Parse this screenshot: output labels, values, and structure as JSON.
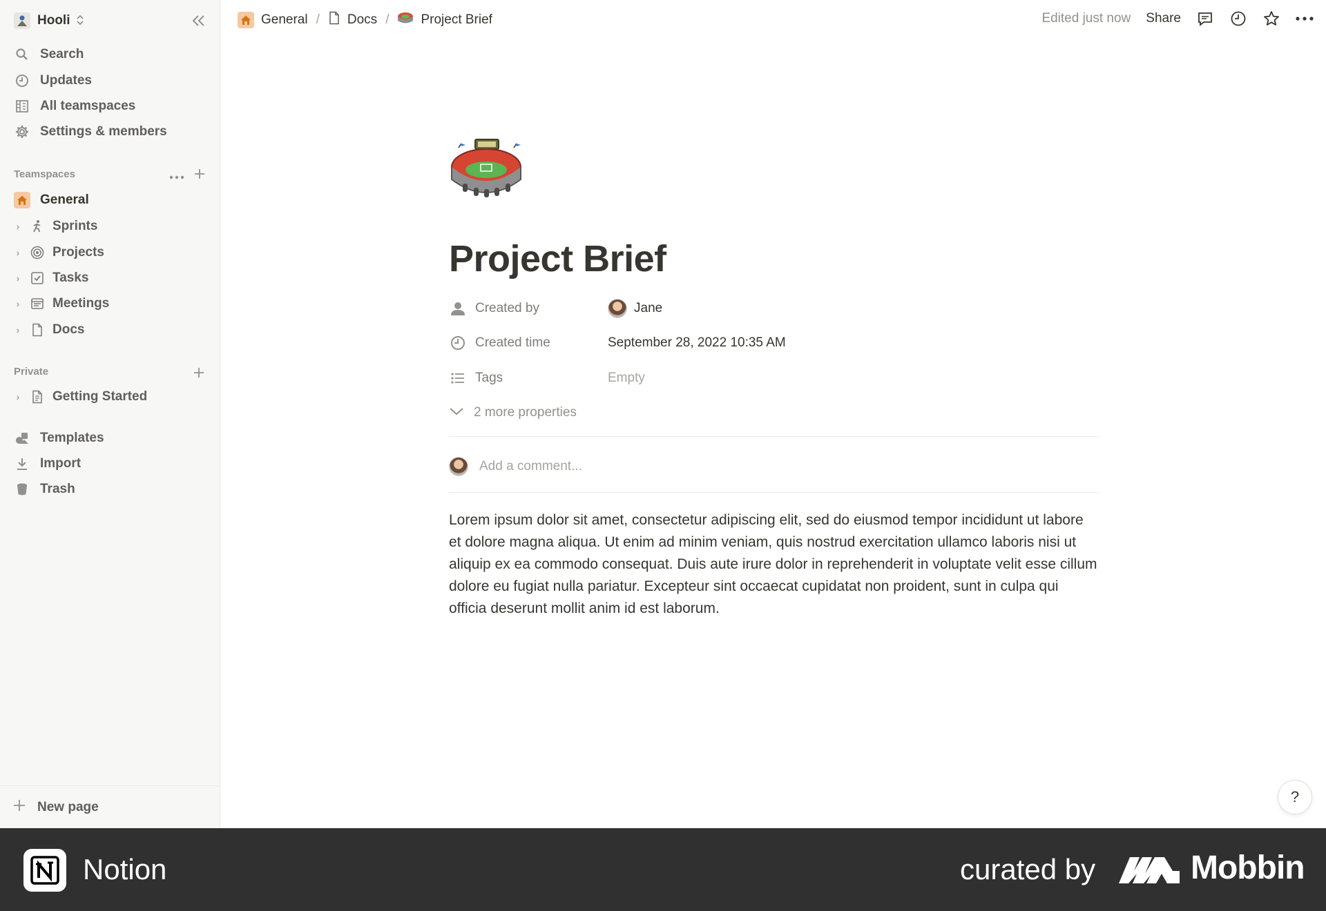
{
  "workspace": {
    "name": "Hooli"
  },
  "sidebar": {
    "nav": [
      {
        "label": "Search",
        "icon": "search-icon"
      },
      {
        "label": "Updates",
        "icon": "clock-icon"
      },
      {
        "label": "All teamspaces",
        "icon": "building-icon"
      },
      {
        "label": "Settings & members",
        "icon": "gear-icon"
      }
    ],
    "teamspaces_label": "Teamspaces",
    "teamspaces": [
      {
        "label": "General",
        "icon": "home-icon"
      },
      {
        "label": "Sprints",
        "icon": "runner-icon"
      },
      {
        "label": "Projects",
        "icon": "target-icon"
      },
      {
        "label": "Tasks",
        "icon": "checkbox-icon"
      },
      {
        "label": "Meetings",
        "icon": "notes-icon"
      },
      {
        "label": "Docs",
        "icon": "page-icon"
      }
    ],
    "private_label": "Private",
    "private": [
      {
        "label": "Getting Started",
        "icon": "document-icon"
      }
    ],
    "bottom": [
      {
        "label": "Templates",
        "icon": "shapes-icon"
      },
      {
        "label": "Import",
        "icon": "download-icon"
      },
      {
        "label": "Trash",
        "icon": "trash-icon"
      }
    ],
    "new_page_label": "New page"
  },
  "topbar": {
    "breadcrumbs": [
      "General",
      "Docs",
      "Project Brief"
    ],
    "edited": "Edited just now",
    "share": "Share"
  },
  "page": {
    "title": "Project Brief",
    "properties": [
      {
        "name": "Created by",
        "value": "Jane",
        "icon": "person-icon"
      },
      {
        "name": "Created time",
        "value": "September 28, 2022 10:35 AM",
        "icon": "clock-icon"
      },
      {
        "name": "Tags",
        "value": "Empty",
        "icon": "list-icon"
      }
    ],
    "more_properties": "2 more properties",
    "comment_placeholder": "Add a comment...",
    "body": "Lorem ipsum dolor sit amet, consectetur adipiscing elit, sed do eiusmod tempor incididunt ut labore et dolore magna aliqua. Ut enim ad minim veniam, quis nostrud exercitation ullamco laboris nisi ut aliquip ex ea commodo consequat. Duis aute irure dolor in reprehenderit in voluptate velit esse cillum dolore eu fugiat nulla pariatur. Excepteur sint occaecat cupidatat non proident, sunt in culpa qui officia deserunt mollit anim id est laborum."
  },
  "help_label": "?",
  "footer": {
    "app_name": "Notion",
    "curated_by": "curated by",
    "brand": "Mobbin"
  },
  "colors": {
    "sidebar_bg": "#f7f7f5",
    "text": "#37352f",
    "muted": "#91918e",
    "footer_bg": "#303030",
    "home_icon_bg": "#f5c9a4"
  }
}
